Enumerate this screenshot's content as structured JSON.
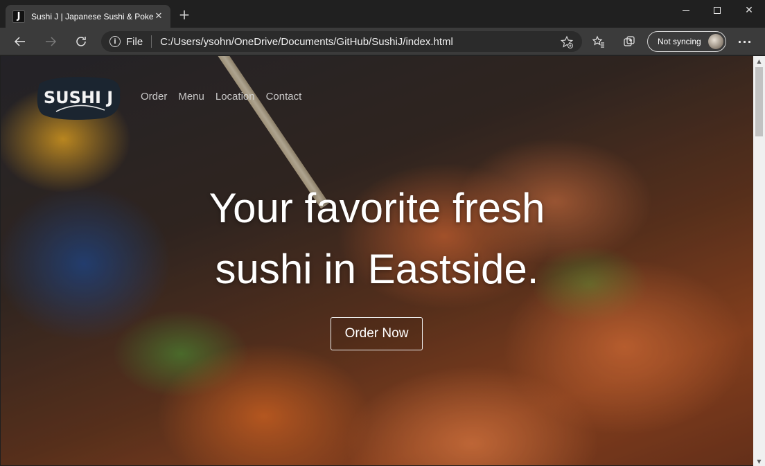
{
  "browser": {
    "tab": {
      "favicon_letter": "J",
      "title": "Sushi J | Japanese Sushi & Poke",
      "close_icon": "close-icon"
    },
    "new_tab_icon": "plus-icon",
    "window_controls": [
      "minimize-icon",
      "maximize-icon",
      "close-icon"
    ],
    "toolbar": {
      "back_icon": "arrow-left-icon",
      "forward_icon": "arrow-right-icon",
      "refresh_icon": "refresh-icon",
      "address": {
        "scheme_label": "File",
        "url": "C:/Users/ysohn/OneDrive/Documents/GitHub/SushiJ/index.html"
      },
      "profile_label": "Not syncing",
      "more_icon": "more-horizontal-icon"
    }
  },
  "page": {
    "logo_text": "SUSHI J",
    "nav": [
      "Order",
      "Menu",
      "Location",
      "Contact"
    ],
    "headline": [
      "Your favorite fresh",
      "sushi in Eastside."
    ],
    "cta_label": "Order Now"
  },
  "colors": {
    "browser_chrome": "#202020",
    "toolbar": "#3b3b3b",
    "headline_text": "#ffffff",
    "nav_text": "#d8d8d8"
  }
}
